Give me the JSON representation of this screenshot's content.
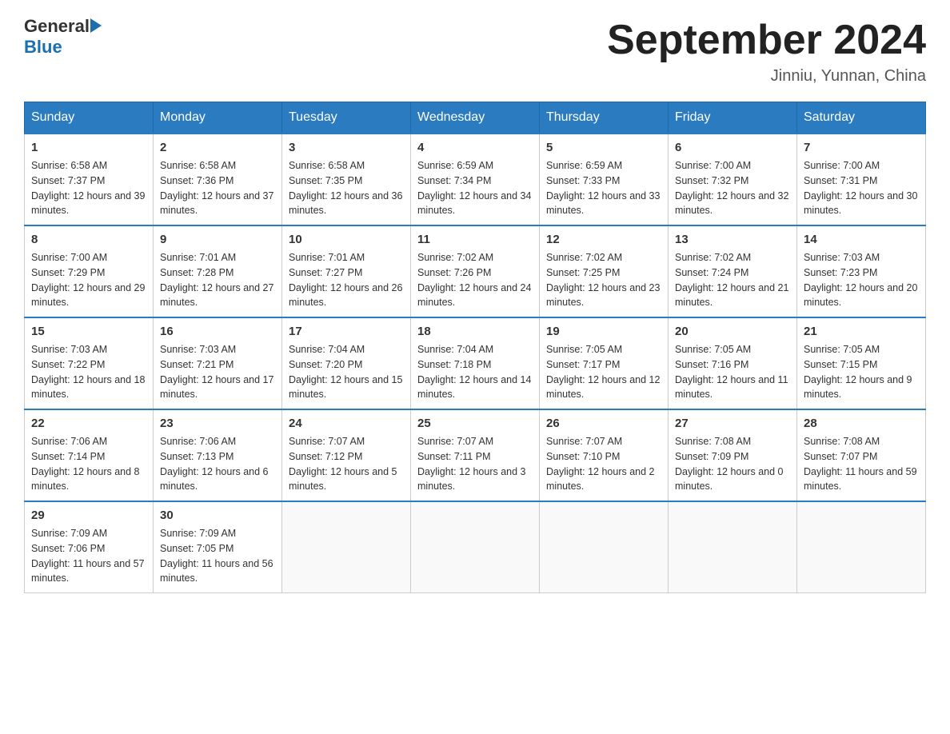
{
  "header": {
    "logo_general": "General",
    "logo_blue": "Blue",
    "month_title": "September 2024",
    "location": "Jinniu, Yunnan, China"
  },
  "days_of_week": [
    "Sunday",
    "Monday",
    "Tuesday",
    "Wednesday",
    "Thursday",
    "Friday",
    "Saturday"
  ],
  "weeks": [
    [
      {
        "day": "1",
        "sunrise": "Sunrise: 6:58 AM",
        "sunset": "Sunset: 7:37 PM",
        "daylight": "Daylight: 12 hours and 39 minutes."
      },
      {
        "day": "2",
        "sunrise": "Sunrise: 6:58 AM",
        "sunset": "Sunset: 7:36 PM",
        "daylight": "Daylight: 12 hours and 37 minutes."
      },
      {
        "day": "3",
        "sunrise": "Sunrise: 6:58 AM",
        "sunset": "Sunset: 7:35 PM",
        "daylight": "Daylight: 12 hours and 36 minutes."
      },
      {
        "day": "4",
        "sunrise": "Sunrise: 6:59 AM",
        "sunset": "Sunset: 7:34 PM",
        "daylight": "Daylight: 12 hours and 34 minutes."
      },
      {
        "day": "5",
        "sunrise": "Sunrise: 6:59 AM",
        "sunset": "Sunset: 7:33 PM",
        "daylight": "Daylight: 12 hours and 33 minutes."
      },
      {
        "day": "6",
        "sunrise": "Sunrise: 7:00 AM",
        "sunset": "Sunset: 7:32 PM",
        "daylight": "Daylight: 12 hours and 32 minutes."
      },
      {
        "day": "7",
        "sunrise": "Sunrise: 7:00 AM",
        "sunset": "Sunset: 7:31 PM",
        "daylight": "Daylight: 12 hours and 30 minutes."
      }
    ],
    [
      {
        "day": "8",
        "sunrise": "Sunrise: 7:00 AM",
        "sunset": "Sunset: 7:29 PM",
        "daylight": "Daylight: 12 hours and 29 minutes."
      },
      {
        "day": "9",
        "sunrise": "Sunrise: 7:01 AM",
        "sunset": "Sunset: 7:28 PM",
        "daylight": "Daylight: 12 hours and 27 minutes."
      },
      {
        "day": "10",
        "sunrise": "Sunrise: 7:01 AM",
        "sunset": "Sunset: 7:27 PM",
        "daylight": "Daylight: 12 hours and 26 minutes."
      },
      {
        "day": "11",
        "sunrise": "Sunrise: 7:02 AM",
        "sunset": "Sunset: 7:26 PM",
        "daylight": "Daylight: 12 hours and 24 minutes."
      },
      {
        "day": "12",
        "sunrise": "Sunrise: 7:02 AM",
        "sunset": "Sunset: 7:25 PM",
        "daylight": "Daylight: 12 hours and 23 minutes."
      },
      {
        "day": "13",
        "sunrise": "Sunrise: 7:02 AM",
        "sunset": "Sunset: 7:24 PM",
        "daylight": "Daylight: 12 hours and 21 minutes."
      },
      {
        "day": "14",
        "sunrise": "Sunrise: 7:03 AM",
        "sunset": "Sunset: 7:23 PM",
        "daylight": "Daylight: 12 hours and 20 minutes."
      }
    ],
    [
      {
        "day": "15",
        "sunrise": "Sunrise: 7:03 AM",
        "sunset": "Sunset: 7:22 PM",
        "daylight": "Daylight: 12 hours and 18 minutes."
      },
      {
        "day": "16",
        "sunrise": "Sunrise: 7:03 AM",
        "sunset": "Sunset: 7:21 PM",
        "daylight": "Daylight: 12 hours and 17 minutes."
      },
      {
        "day": "17",
        "sunrise": "Sunrise: 7:04 AM",
        "sunset": "Sunset: 7:20 PM",
        "daylight": "Daylight: 12 hours and 15 minutes."
      },
      {
        "day": "18",
        "sunrise": "Sunrise: 7:04 AM",
        "sunset": "Sunset: 7:18 PM",
        "daylight": "Daylight: 12 hours and 14 minutes."
      },
      {
        "day": "19",
        "sunrise": "Sunrise: 7:05 AM",
        "sunset": "Sunset: 7:17 PM",
        "daylight": "Daylight: 12 hours and 12 minutes."
      },
      {
        "day": "20",
        "sunrise": "Sunrise: 7:05 AM",
        "sunset": "Sunset: 7:16 PM",
        "daylight": "Daylight: 12 hours and 11 minutes."
      },
      {
        "day": "21",
        "sunrise": "Sunrise: 7:05 AM",
        "sunset": "Sunset: 7:15 PM",
        "daylight": "Daylight: 12 hours and 9 minutes."
      }
    ],
    [
      {
        "day": "22",
        "sunrise": "Sunrise: 7:06 AM",
        "sunset": "Sunset: 7:14 PM",
        "daylight": "Daylight: 12 hours and 8 minutes."
      },
      {
        "day": "23",
        "sunrise": "Sunrise: 7:06 AM",
        "sunset": "Sunset: 7:13 PM",
        "daylight": "Daylight: 12 hours and 6 minutes."
      },
      {
        "day": "24",
        "sunrise": "Sunrise: 7:07 AM",
        "sunset": "Sunset: 7:12 PM",
        "daylight": "Daylight: 12 hours and 5 minutes."
      },
      {
        "day": "25",
        "sunrise": "Sunrise: 7:07 AM",
        "sunset": "Sunset: 7:11 PM",
        "daylight": "Daylight: 12 hours and 3 minutes."
      },
      {
        "day": "26",
        "sunrise": "Sunrise: 7:07 AM",
        "sunset": "Sunset: 7:10 PM",
        "daylight": "Daylight: 12 hours and 2 minutes."
      },
      {
        "day": "27",
        "sunrise": "Sunrise: 7:08 AM",
        "sunset": "Sunset: 7:09 PM",
        "daylight": "Daylight: 12 hours and 0 minutes."
      },
      {
        "day": "28",
        "sunrise": "Sunrise: 7:08 AM",
        "sunset": "Sunset: 7:07 PM",
        "daylight": "Daylight: 11 hours and 59 minutes."
      }
    ],
    [
      {
        "day": "29",
        "sunrise": "Sunrise: 7:09 AM",
        "sunset": "Sunset: 7:06 PM",
        "daylight": "Daylight: 11 hours and 57 minutes."
      },
      {
        "day": "30",
        "sunrise": "Sunrise: 7:09 AM",
        "sunset": "Sunset: 7:05 PM",
        "daylight": "Daylight: 11 hours and 56 minutes."
      },
      null,
      null,
      null,
      null,
      null
    ]
  ]
}
